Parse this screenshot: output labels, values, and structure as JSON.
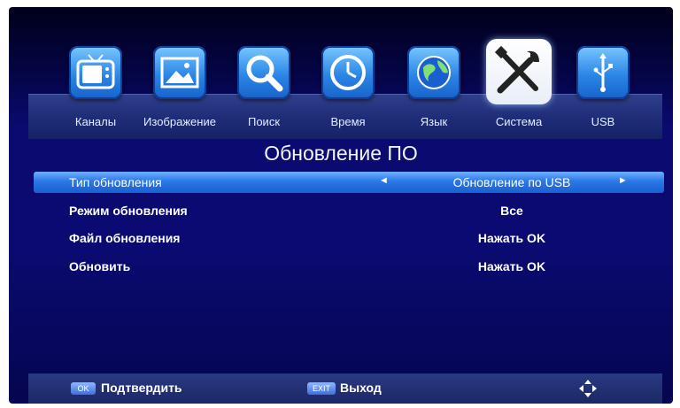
{
  "menu": {
    "tabs": [
      {
        "label": "Каналы",
        "icon": "tv-icon"
      },
      {
        "label": "Изображение",
        "icon": "picture-icon"
      },
      {
        "label": "Поиск",
        "icon": "search-icon"
      },
      {
        "label": "Время",
        "icon": "clock-icon"
      },
      {
        "label": "Язык",
        "icon": "globe-icon"
      },
      {
        "label": "Система",
        "icon": "tools-icon",
        "active": true
      },
      {
        "label": "USB",
        "icon": "usb-icon"
      }
    ]
  },
  "page_title": "Обновление ПО",
  "settings": [
    {
      "label": "Тип обновления",
      "value": "Обновление по USB",
      "selected": true
    },
    {
      "label": "Режим обновления",
      "value": "Все"
    },
    {
      "label": "Файл обновления",
      "value": "Нажать OK"
    },
    {
      "label": "Обновить",
      "value": "Нажать OK"
    }
  ],
  "footer": {
    "ok_key": "OK",
    "ok_label": "Подтвердить",
    "exit_key": "EXIT",
    "exit_label": "Выход",
    "nav_icon": "dpad-icon"
  },
  "colors": {
    "background": "#0a0a70",
    "selected_row": "#2a78e6",
    "icon_tile": "#2b86e6"
  }
}
